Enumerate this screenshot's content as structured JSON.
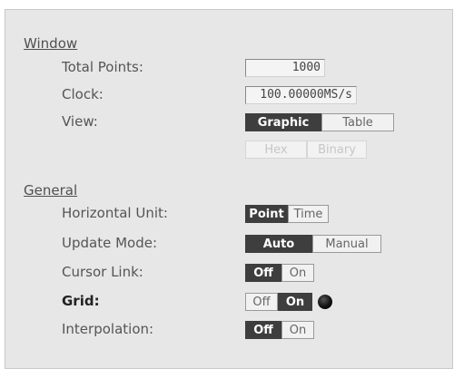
{
  "window_section": {
    "title": "Window",
    "total_points": {
      "label": "Total Points:",
      "value": "1000"
    },
    "clock": {
      "label": "Clock:",
      "value": "100.00000MS/s"
    },
    "view": {
      "label": "View:",
      "options": [
        "Graphic",
        "Table"
      ],
      "selected": "Graphic",
      "format_options": [
        "Hex",
        "Binary"
      ]
    }
  },
  "general_section": {
    "title": "General",
    "horizontal_unit": {
      "label": "Horizontal Unit:",
      "options": [
        "Point",
        "Time"
      ],
      "selected": "Point"
    },
    "update_mode": {
      "label": "Update Mode:",
      "options": [
        "Auto",
        "Manual"
      ],
      "selected": "Auto"
    },
    "cursor_link": {
      "label": "Cursor Link:",
      "options": [
        "Off",
        "On"
      ],
      "selected": "Off"
    },
    "grid": {
      "label": "Grid:",
      "options": [
        "Off",
        "On"
      ],
      "selected": "On",
      "indicator": "focus-ball-icon"
    },
    "interpolation": {
      "label": "Interpolation:",
      "options": [
        "Off",
        "On"
      ],
      "selected": "Off"
    }
  }
}
